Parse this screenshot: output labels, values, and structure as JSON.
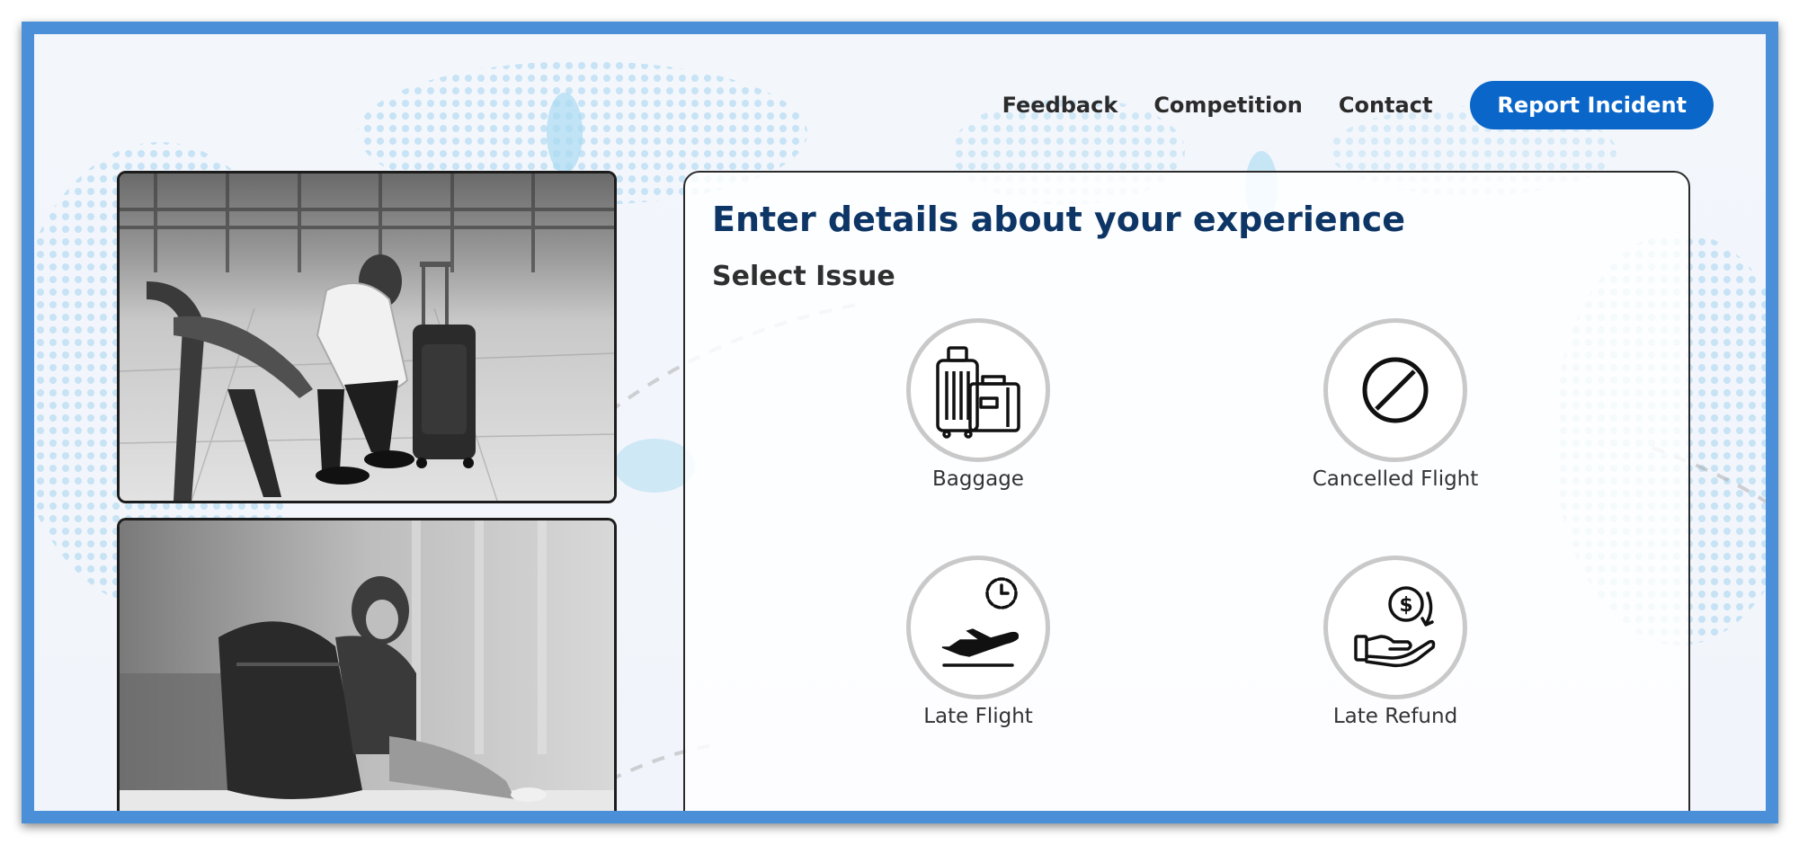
{
  "nav": {
    "links": [
      "Feedback",
      "Competition",
      "Contact"
    ],
    "cta_label": "Report Incident"
  },
  "panel": {
    "title": "Enter details about your experience",
    "subtitle": "Select Issue",
    "issues": [
      {
        "label": "Baggage",
        "icon": "luggage-icon"
      },
      {
        "label": "Cancelled Flight",
        "icon": "cancel-icon"
      },
      {
        "label": "Late Flight",
        "icon": "late-flight-icon"
      },
      {
        "label": "Late Refund",
        "icon": "refund-icon"
      }
    ]
  },
  "colors": {
    "accent": "#0a66c8",
    "frame": "#4a8fd8",
    "title": "#0d3566"
  }
}
